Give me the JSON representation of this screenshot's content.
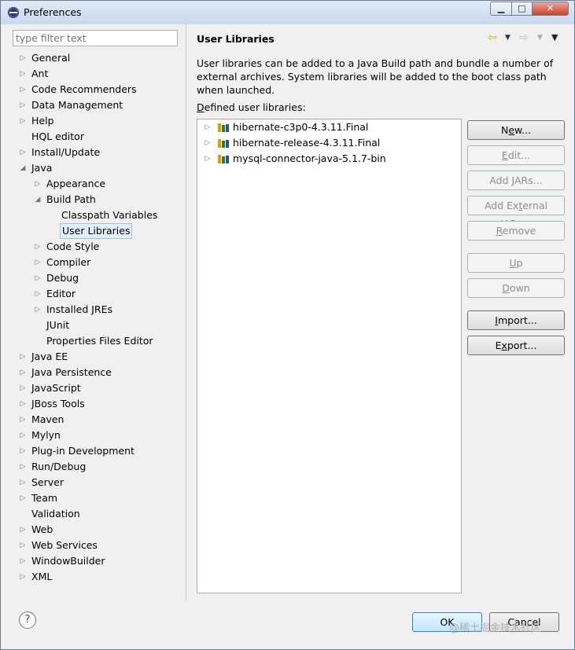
{
  "window": {
    "title": "Preferences"
  },
  "filter": {
    "placeholder": "type filter text"
  },
  "tree": [
    {
      "label": "General",
      "level": 0,
      "twisty": "collapsed"
    },
    {
      "label": "Ant",
      "level": 0,
      "twisty": "collapsed"
    },
    {
      "label": "Code Recommenders",
      "level": 0,
      "twisty": "collapsed"
    },
    {
      "label": "Data Management",
      "level": 0,
      "twisty": "collapsed"
    },
    {
      "label": "Help",
      "level": 0,
      "twisty": "collapsed"
    },
    {
      "label": "HQL editor",
      "level": 0,
      "twisty": "none"
    },
    {
      "label": "Install/Update",
      "level": 0,
      "twisty": "collapsed"
    },
    {
      "label": "Java",
      "level": 0,
      "twisty": "expanded"
    },
    {
      "label": "Appearance",
      "level": 1,
      "twisty": "collapsed"
    },
    {
      "label": "Build Path",
      "level": 1,
      "twisty": "expanded"
    },
    {
      "label": "Classpath Variables",
      "level": 2,
      "twisty": "none"
    },
    {
      "label": "User Libraries",
      "level": 2,
      "twisty": "none",
      "selected": true
    },
    {
      "label": "Code Style",
      "level": 1,
      "twisty": "collapsed"
    },
    {
      "label": "Compiler",
      "level": 1,
      "twisty": "collapsed"
    },
    {
      "label": "Debug",
      "level": 1,
      "twisty": "collapsed"
    },
    {
      "label": "Editor",
      "level": 1,
      "twisty": "collapsed"
    },
    {
      "label": "Installed JREs",
      "level": 1,
      "twisty": "collapsed"
    },
    {
      "label": "JUnit",
      "level": 1,
      "twisty": "none"
    },
    {
      "label": "Properties Files Editor",
      "level": 1,
      "twisty": "none"
    },
    {
      "label": "Java EE",
      "level": 0,
      "twisty": "collapsed"
    },
    {
      "label": "Java Persistence",
      "level": 0,
      "twisty": "collapsed"
    },
    {
      "label": "JavaScript",
      "level": 0,
      "twisty": "collapsed"
    },
    {
      "label": "JBoss Tools",
      "level": 0,
      "twisty": "collapsed"
    },
    {
      "label": "Maven",
      "level": 0,
      "twisty": "collapsed"
    },
    {
      "label": "Mylyn",
      "level": 0,
      "twisty": "collapsed"
    },
    {
      "label": "Plug-in Development",
      "level": 0,
      "twisty": "collapsed"
    },
    {
      "label": "Run/Debug",
      "level": 0,
      "twisty": "collapsed"
    },
    {
      "label": "Server",
      "level": 0,
      "twisty": "collapsed"
    },
    {
      "label": "Team",
      "level": 0,
      "twisty": "collapsed"
    },
    {
      "label": "Validation",
      "level": 0,
      "twisty": "none"
    },
    {
      "label": "Web",
      "level": 0,
      "twisty": "collapsed"
    },
    {
      "label": "Web Services",
      "level": 0,
      "twisty": "collapsed"
    },
    {
      "label": "WindowBuilder",
      "level": 0,
      "twisty": "collapsed"
    },
    {
      "label": "XML",
      "level": 0,
      "twisty": "collapsed"
    }
  ],
  "page": {
    "title": "User Libraries",
    "description": "User libraries can be added to a Java Build path and bundle a number of external archives. System libraries will be added to the boot class path when launched.",
    "defined_label": "Defined user libraries:",
    "libraries": [
      "hibernate-c3p0-4.3.11.Final",
      "hibernate-release-4.3.11.Final",
      "mysql-connector-java-5.1.7-bin"
    ],
    "buttons": [
      {
        "label": "New...",
        "enabled": true
      },
      {
        "label": "Edit...",
        "enabled": false
      },
      {
        "label": "Add JARs...",
        "enabled": false
      },
      {
        "label": "Add External JARs...",
        "enabled": false
      },
      {
        "label": "Remove",
        "enabled": false
      },
      {
        "label": "Up",
        "enabled": false
      },
      {
        "label": "Down",
        "enabled": false
      },
      {
        "label": "Import...",
        "enabled": true
      },
      {
        "label": "Export...",
        "enabled": true
      }
    ]
  },
  "footer": {
    "ok_label": "OK",
    "cancel_label": "Cancel",
    "watermark": "@稀土掘金技术社区"
  },
  "colors": {
    "selection_bg": "#e4effb",
    "selection_border": "#99c2ea",
    "nav_back_arrow": "#f0c000"
  }
}
